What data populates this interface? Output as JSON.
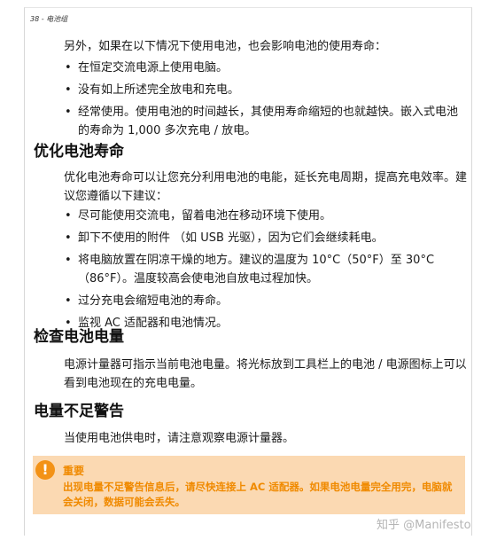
{
  "header": {
    "running_head": "38 - 电池组"
  },
  "intro": {
    "paragraph": "另外，如果在以下情况下使用电池，也会影响电池的使用寿命：",
    "bullets": [
      "在恒定交流电源上使用电脑。",
      "没有如上所述完全放电和充电。",
      "经常使用。使用电池的时间越长，其使用寿命缩短的也就越快。嵌入式电池的寿命为 1,000 多次充电 / 放电。"
    ]
  },
  "optimize": {
    "heading": "优化电池寿命",
    "paragraph": "优化电池寿命可以让您充分利用电池的电能，延长充电周期，提高充电效率。建议您遵循以下建议：",
    "bullets": [
      "尽可能使用交流电，留着电池在移动环境下使用。",
      "卸下不使用的附件 （如 USB 光驱），因为它们会继续耗电。",
      "将电脑放置在阴凉干燥的地方。建议的温度为 10°C（50°F）至 30°C（86°F）。温度较高会使电池自放电过程加快。",
      "过分充电会缩短电池的寿命。",
      "监视 AC 适配器和电池情况。"
    ]
  },
  "check": {
    "heading": "检查电池电量",
    "paragraph": "电源计量器可指示当前电池电量。将光标放到工具栏上的电池 / 电源图标上可以看到电池现在的充电电量。"
  },
  "low": {
    "heading": "电量不足警告",
    "paragraph": "当使用电池供电时，请注意观察电源计量器。"
  },
  "notice": {
    "icon_glyph": "!",
    "title": "重要",
    "text": "出现电量不足警告信息后，请尽快连接上 AC 适配器。如果电池电量完全用完，电脑就会关闭，数据可能会丢失。",
    "accent_color": "#f08a00",
    "background_color": "#fbd9b2"
  },
  "watermark": {
    "text": "知乎 @Manifesto"
  }
}
